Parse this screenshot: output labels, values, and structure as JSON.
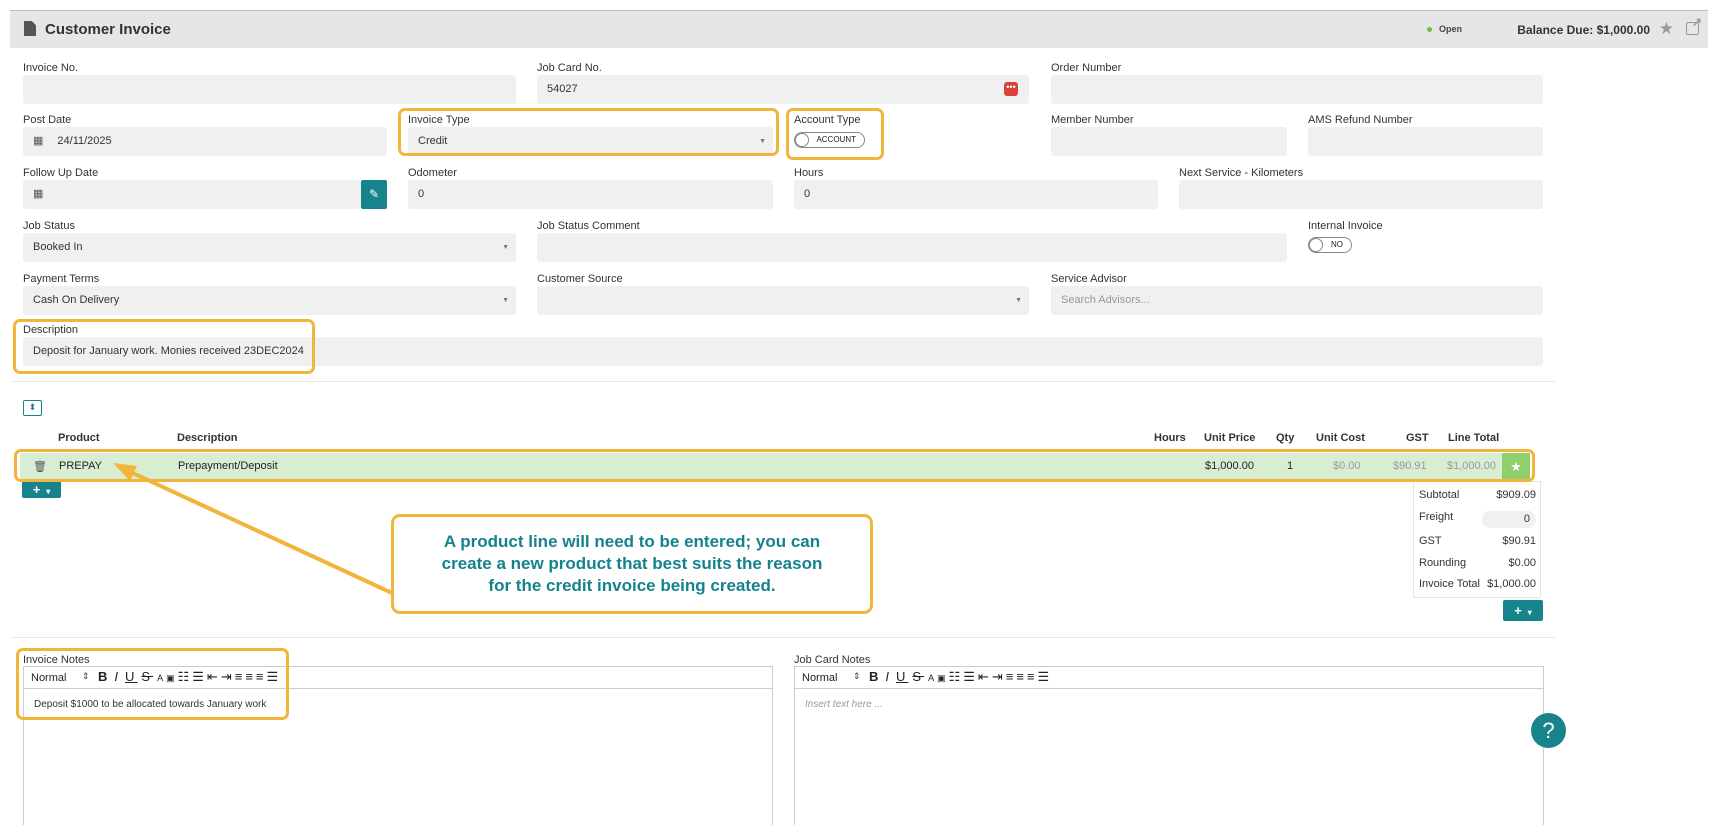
{
  "header": {
    "title": "Customer Invoice",
    "status": "Open",
    "balance": "Balance Due: $1,000.00"
  },
  "fields": {
    "invoice_no": {
      "label": "Invoice No.",
      "value": ""
    },
    "job_card_no": {
      "label": "Job Card No.",
      "value": "54027"
    },
    "order_number": {
      "label": "Order Number",
      "value": ""
    },
    "post_date": {
      "label": "Post Date",
      "value": "24/11/2025"
    },
    "invoice_type": {
      "label": "Invoice Type",
      "value": "Credit"
    },
    "account_type": {
      "label": "Account Type",
      "toggle": "ACCOUNT"
    },
    "member_number": {
      "label": "Member Number",
      "value": ""
    },
    "ams_refund": {
      "label": "AMS Refund Number",
      "value": ""
    },
    "follow_up": {
      "label": "Follow Up Date",
      "value": ""
    },
    "odometer": {
      "label": "Odometer",
      "value": "0"
    },
    "hours": {
      "label": "Hours",
      "value": "0"
    },
    "next_service": {
      "label": "Next Service - Kilometers",
      "value": ""
    },
    "job_status": {
      "label": "Job Status",
      "value": "Booked In"
    },
    "job_status_comment": {
      "label": "Job Status Comment",
      "value": ""
    },
    "internal_invoice": {
      "label": "Internal Invoice",
      "toggle": "NO"
    },
    "payment_terms": {
      "label": "Payment Terms",
      "value": "Cash On Delivery"
    },
    "customer_source": {
      "label": "Customer Source",
      "value": ""
    },
    "service_advisor": {
      "label": "Service Advisor",
      "placeholder": "Search Advisors..."
    },
    "description": {
      "label": "Description",
      "value": "Deposit for January work. Monies received 23DEC2024"
    }
  },
  "table": {
    "headers": {
      "product": "Product",
      "description": "Description",
      "hours": "Hours",
      "unit_price": "Unit Price",
      "qty": "Qty",
      "unit_cost": "Unit Cost",
      "gst": "GST",
      "line_total": "Line Total"
    },
    "rows": [
      {
        "product": "PREPAY",
        "description": "Prepayment/Deposit",
        "unit_price": "$1,000.00",
        "qty": "1",
        "unit_cost": "$0.00",
        "gst": "$90.91",
        "line_total": "$1,000.00"
      }
    ]
  },
  "totals": {
    "subtotal_label": "Subtotal",
    "subtotal": "$909.09",
    "freight_label": "Freight",
    "freight": "0",
    "gst_label": "GST",
    "gst": "$90.91",
    "rounding_label": "Rounding",
    "rounding": "$0.00",
    "invoice_total_label": "Invoice Total",
    "invoice_total": "$1,000.00"
  },
  "callout": {
    "line1": "A product line will need to be entered; you can",
    "line2": "create a new product that best suits the reason",
    "line3": "for the credit invoice being created."
  },
  "notes": {
    "invoice_notes_label": "Invoice Notes",
    "invoice_notes_text": "Deposit $1000 to be allocated towards January work",
    "job_card_notes_label": "Job Card Notes",
    "job_card_notes_placeholder": "Insert text here ...",
    "format": "Normal"
  },
  "help": "?",
  "colors": {
    "teal": "#17848c",
    "highlight": "#f0b53a",
    "row_bg": "#d8eed2",
    "open_dot": "#6fbf4b"
  }
}
